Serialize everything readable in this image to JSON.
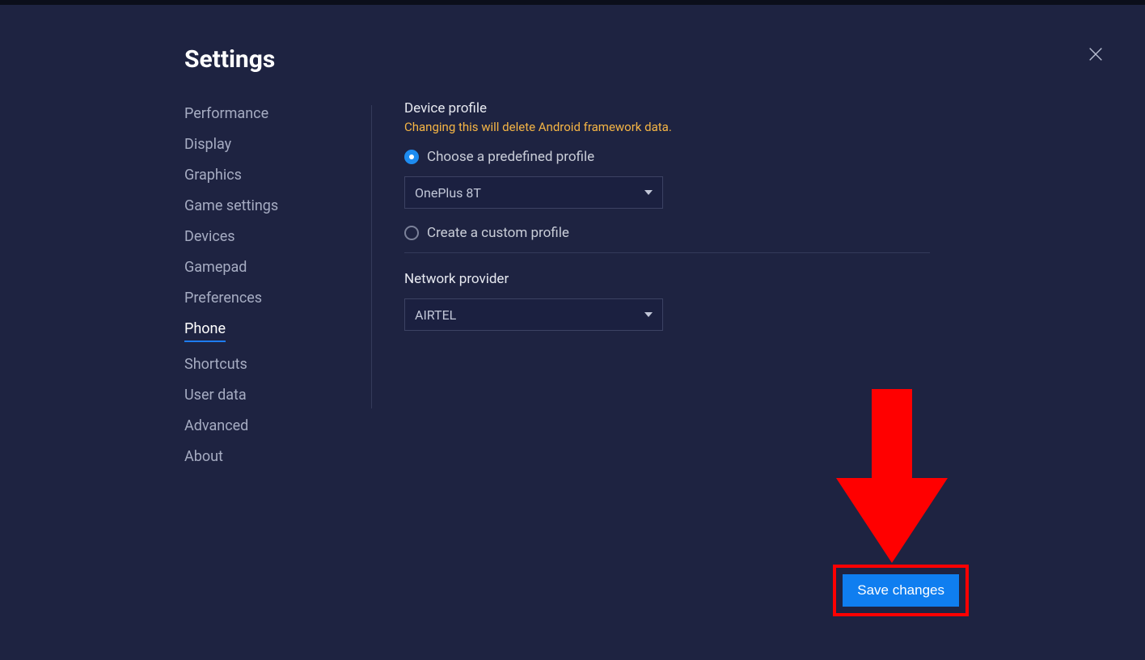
{
  "title": "Settings",
  "sidebar": {
    "items": [
      {
        "label": "Performance",
        "active": false
      },
      {
        "label": "Display",
        "active": false
      },
      {
        "label": "Graphics",
        "active": false
      },
      {
        "label": "Game settings",
        "active": false
      },
      {
        "label": "Devices",
        "active": false
      },
      {
        "label": "Gamepad",
        "active": false
      },
      {
        "label": "Preferences",
        "active": false
      },
      {
        "label": "Phone",
        "active": true
      },
      {
        "label": "Shortcuts",
        "active": false
      },
      {
        "label": "User data",
        "active": false
      },
      {
        "label": "Advanced",
        "active": false
      },
      {
        "label": "About",
        "active": false
      }
    ]
  },
  "device_profile": {
    "heading": "Device profile",
    "warning": "Changing this will delete Android framework data.",
    "option_predefined": "Choose a predefined profile",
    "option_custom": "Create a custom profile",
    "selected_profile": "OnePlus 8T"
  },
  "network_provider": {
    "heading": "Network provider",
    "selected": "AIRTEL"
  },
  "buttons": {
    "save": "Save changes"
  }
}
